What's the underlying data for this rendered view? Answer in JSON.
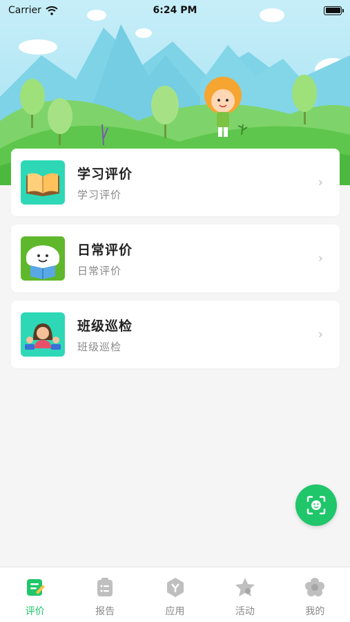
{
  "status_bar": {
    "carrier": "Carrier",
    "time": "6:24 PM"
  },
  "cards": [
    {
      "title": "学习评价",
      "subtitle": "学习评价",
      "icon": "book-icon",
      "color": "#2ed8b6"
    },
    {
      "title": "日常评价",
      "subtitle": "日常评价",
      "icon": "cloud-reading-icon",
      "color": "#5fb82c"
    },
    {
      "title": "班级巡检",
      "subtitle": "班级巡检",
      "icon": "class-people-icon",
      "color": "#2ed8b6"
    }
  ],
  "fab": {
    "icon": "face-scan-icon"
  },
  "tabs": [
    {
      "label": "评价",
      "icon": "evaluate-icon",
      "active": true
    },
    {
      "label": "报告",
      "icon": "report-icon",
      "active": false
    },
    {
      "label": "应用",
      "icon": "apps-icon",
      "active": false
    },
    {
      "label": "活动",
      "icon": "activity-icon",
      "active": false
    },
    {
      "label": "我的",
      "icon": "profile-icon",
      "active": false
    }
  ],
  "colors": {
    "accent": "#1fc66a",
    "sky": "#8fdcf0",
    "inactive": "#888888"
  }
}
